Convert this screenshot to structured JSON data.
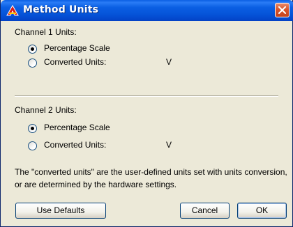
{
  "window": {
    "title": "Method Units"
  },
  "channels": [
    {
      "heading": "Channel 1 Units:",
      "options": [
        {
          "label": "Percentage Scale",
          "checked": true
        },
        {
          "label": "Converted Units:",
          "checked": false,
          "unit": "V"
        }
      ]
    },
    {
      "heading": "Channel 2 Units:",
      "options": [
        {
          "label": "Percentage Scale",
          "checked": true
        },
        {
          "label": "Converted Units:",
          "checked": false,
          "unit": "V"
        }
      ]
    }
  ],
  "note": "The \"converted units\" are the user-defined units set with units conversion, or are determined by the hardware settings.",
  "buttons": {
    "defaults": "Use Defaults",
    "cancel": "Cancel",
    "ok": "OK"
  },
  "icons": {
    "app": "app-logo-icon",
    "close": "close-icon"
  }
}
